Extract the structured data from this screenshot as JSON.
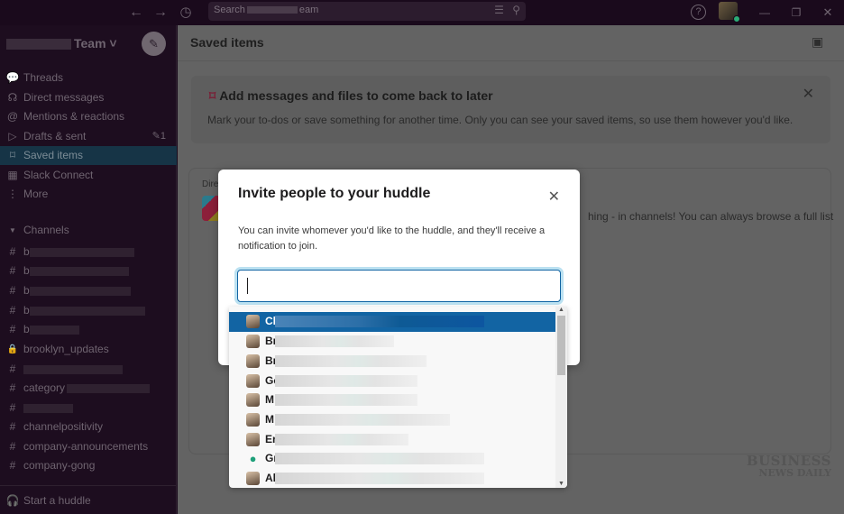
{
  "titlebar": {
    "back_icon": "←",
    "forward_icon": "→",
    "history_icon": "◷",
    "search_prefix": "Search",
    "search_suffix": "eam",
    "filter_icon": "☰",
    "search_icon": "⚲",
    "help_icon": "?",
    "minimize_icon": "—",
    "restore_icon": "❐",
    "close_icon": "✕"
  },
  "sidebar": {
    "team_name": "Team ˅",
    "compose_icon": "✎",
    "nav": [
      {
        "label": "Threads",
        "icon": "💬"
      },
      {
        "label": "Direct messages",
        "icon": "☊"
      },
      {
        "label": "Mentions & reactions",
        "icon": "@"
      },
      {
        "label": "Drafts & sent",
        "icon": "▷",
        "badge": "✎1"
      },
      {
        "label": "Saved items",
        "icon": "⌑",
        "active": true
      },
      {
        "label": "Slack Connect",
        "icon": "▦"
      },
      {
        "label": "More",
        "icon": "⋮"
      }
    ],
    "channels_header": "Channels",
    "channels": [
      {
        "prefix": "#",
        "name": "b"
      },
      {
        "prefix": "#",
        "name": "b"
      },
      {
        "prefix": "#",
        "name": "b"
      },
      {
        "prefix": "#",
        "name": "b"
      },
      {
        "prefix": "#",
        "name": "b"
      },
      {
        "prefix": "🔒",
        "name": "brooklyn_updates"
      },
      {
        "prefix": "#",
        "name": ""
      },
      {
        "prefix": "#",
        "name": "category"
      },
      {
        "prefix": "#",
        "name": ""
      },
      {
        "prefix": "#",
        "name": "channelpositivity"
      },
      {
        "prefix": "#",
        "name": "company-announcements"
      },
      {
        "prefix": "#",
        "name": "company-gong"
      }
    ],
    "huddle_label": "Start a huddle"
  },
  "main": {
    "title": "Saved items",
    "banner": {
      "title": "Add messages and files to come back to later",
      "description": "Mark your to-dos or save something for another time. Only you can see your saved items, so use them however you'd like."
    },
    "card": {
      "label": "Dire",
      "text": "hing - in channels! You can always browse a full list"
    },
    "watermark": {
      "line1": "BUSINESS",
      "line2": "NEWS DAILY"
    }
  },
  "modal": {
    "title": "Invite people to your huddle",
    "description": "You can invite whomever you'd like to the huddle, and they'll receive a notification to join.",
    "input_value": "",
    "suggestions": [
      {
        "name": "Cl",
        "selected": true
      },
      {
        "name": "Br"
      },
      {
        "name": "Br"
      },
      {
        "name": "Ge"
      },
      {
        "name": "M"
      },
      {
        "name": "M"
      },
      {
        "name": "Er"
      },
      {
        "name": "Gr",
        "generic_avatar": true
      },
      {
        "name": "Al"
      }
    ]
  },
  "colors": {
    "sidebar_bg": "#1d0d1f",
    "active_item": "#163446",
    "selection": "#1264a3",
    "bookmark": "#7a1d35"
  }
}
